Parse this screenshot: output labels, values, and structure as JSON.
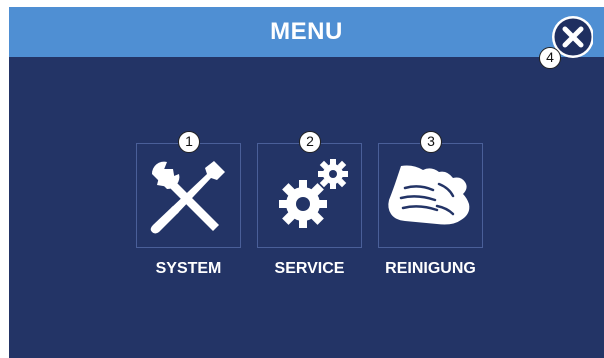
{
  "header": {
    "title": "MENU",
    "background": "#4f8fd3"
  },
  "screen": {
    "background": "#233466"
  },
  "close_button": {
    "icon": "close-icon",
    "badge": "4"
  },
  "tiles": [
    {
      "label": "SYSTEM",
      "icon": "tools-icon",
      "badge": "1"
    },
    {
      "label": "SERVICE",
      "icon": "gears-icon",
      "badge": "2"
    },
    {
      "label": "REINIGUNG",
      "icon": "cleaning-cloth-icon",
      "badge": "3"
    }
  ]
}
